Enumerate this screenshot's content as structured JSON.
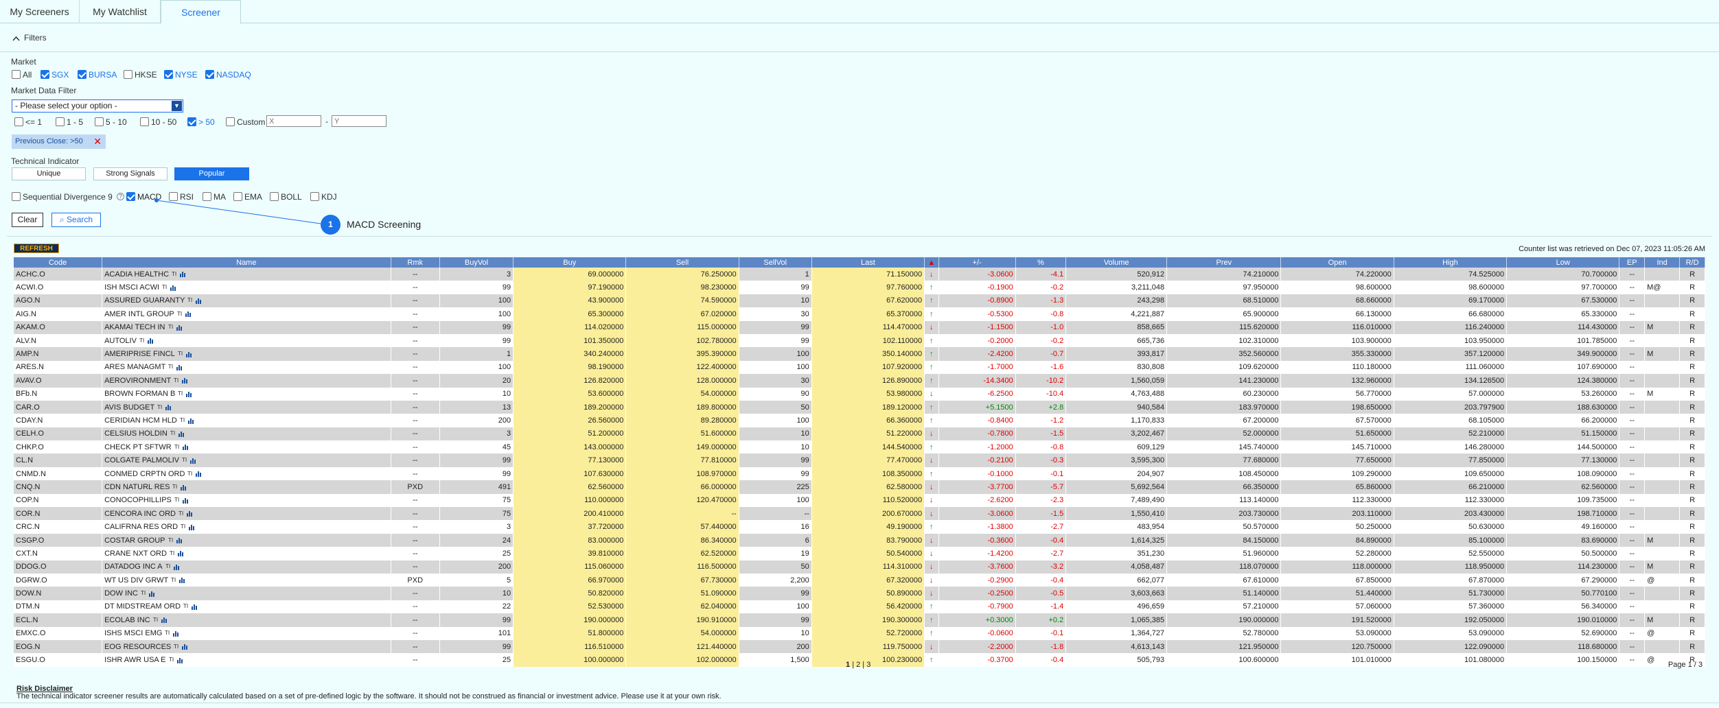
{
  "tabs": [
    {
      "label": "My Screeners",
      "active": false
    },
    {
      "label": "My Watchlist",
      "active": false
    },
    {
      "label": "Screener",
      "active": true
    }
  ],
  "filters": {
    "title": "Filters",
    "market_label": "Market",
    "markets": [
      {
        "label": "All",
        "checked": false
      },
      {
        "label": "SGX",
        "checked": true
      },
      {
        "label": "BURSA",
        "checked": true
      },
      {
        "label": "HKSE",
        "checked": false
      },
      {
        "label": "NYSE",
        "checked": true
      },
      {
        "label": "NASDAQ",
        "checked": true
      }
    ],
    "market_data_label": "Market Data Filter",
    "select_value": "- Please select your option -",
    "price_ranges": [
      {
        "label": "<= 1",
        "checked": false
      },
      {
        "label": "1 - 5",
        "checked": false
      },
      {
        "label": "5 - 10",
        "checked": false
      },
      {
        "label": "10 - 50",
        "checked": false
      },
      {
        "label": "> 50",
        "checked": true
      },
      {
        "label": "Custom",
        "checked": false
      }
    ],
    "custom_x_placeholder": "X",
    "custom_dash": "-",
    "custom_y_placeholder": "Y",
    "chip_label": "Previous Close: >50",
    "tech_label": "Technical Indicator",
    "tech_tabs": [
      {
        "label": "Unique",
        "active": false
      },
      {
        "label": "Strong Signals",
        "active": false
      },
      {
        "label": "Popular",
        "active": true
      }
    ],
    "indicators": [
      {
        "label": "Sequential Divergence 9",
        "checked": false
      },
      {
        "label": "MACD",
        "checked": true
      },
      {
        "label": "RSI",
        "checked": false
      },
      {
        "label": "MA",
        "checked": false
      },
      {
        "label": "EMA",
        "checked": false
      },
      {
        "label": "BOLL",
        "checked": false
      },
      {
        "label": "KDJ",
        "checked": false
      }
    ],
    "help_glyph": "?",
    "clear_label": "Clear",
    "search_label": "Search"
  },
  "callout": {
    "number": "1",
    "text": "MACD Screening"
  },
  "refresh_label": "REFRESH",
  "retrieved_text": "Counter list was retrieved on Dec 07, 2023 11:05:26 AM",
  "table": {
    "headers": [
      "Code",
      "Name",
      "Rmk",
      "BuyVol",
      "Buy",
      "Sell",
      "SellVol",
      "Last",
      "▲",
      "+/-",
      "%",
      "Volume",
      "Prev",
      "Open",
      "High",
      "Low",
      "EP",
      "Ind",
      "R/D"
    ],
    "rows": [
      [
        "ACHC.O",
        "ACADIA HEALTHC",
        "--",
        "3",
        "69.000000",
        "76.250000",
        "1",
        "71.150000",
        "down",
        "-3.0600",
        "-4.1",
        "520,912",
        "74.210000",
        "74.220000",
        "74.525000",
        "70.700000",
        "--",
        "",
        "R"
      ],
      [
        "ACWI.O",
        "ISH MSCI ACWI",
        "--",
        "99",
        "97.190000",
        "98.230000",
        "99",
        "97.760000",
        "up",
        "-0.1900",
        "-0.2",
        "3,211,048",
        "97.950000",
        "98.600000",
        "98.600000",
        "97.700000",
        "--",
        "M@",
        "R"
      ],
      [
        "AGO.N",
        "ASSURED GUARANTY",
        "--",
        "100",
        "43.900000",
        "74.590000",
        "10",
        "67.620000",
        "up",
        "-0.8900",
        "-1.3",
        "243,298",
        "68.510000",
        "68.660000",
        "69.170000",
        "67.530000",
        "--",
        "",
        "R"
      ],
      [
        "AIG.N",
        "AMER INTL GROUP",
        "--",
        "100",
        "65.300000",
        "67.020000",
        "30",
        "65.370000",
        "up",
        "-0.5300",
        "-0.8",
        "4,221,887",
        "65.900000",
        "66.130000",
        "66.680000",
        "65.330000",
        "--",
        "",
        "R"
      ],
      [
        "AKAM.O",
        "AKAMAI TECH IN",
        "--",
        "99",
        "114.020000",
        "115.000000",
        "99",
        "114.470000",
        "down",
        "-1.1500",
        "-1.0",
        "858,665",
        "115.620000",
        "116.010000",
        "116.240000",
        "114.430000",
        "--",
        "M",
        "R"
      ],
      [
        "ALV.N",
        "AUTOLIV",
        "--",
        "99",
        "101.350000",
        "102.780000",
        "99",
        "102.110000",
        "up",
        "-0.2000",
        "-0.2",
        "665,736",
        "102.310000",
        "103.900000",
        "103.950000",
        "101.785000",
        "--",
        "",
        "R"
      ],
      [
        "AMP.N",
        "AMERIPRISE FINCL",
        "--",
        "1",
        "340.240000",
        "395.390000",
        "100",
        "350.140000",
        "up",
        "-2.4200",
        "-0.7",
        "393,817",
        "352.560000",
        "355.330000",
        "357.120000",
        "349.900000",
        "--",
        "M",
        "R"
      ],
      [
        "ARES.N",
        "ARES MANAGMT",
        "--",
        "100",
        "98.190000",
        "122.400000",
        "100",
        "107.920000",
        "up",
        "-1.7000",
        "-1.6",
        "830,808",
        "109.620000",
        "110.180000",
        "111.060000",
        "107.690000",
        "--",
        "",
        "R"
      ],
      [
        "AVAV.O",
        "AEROVIRONMENT",
        "--",
        "20",
        "126.820000",
        "128.000000",
        "30",
        "126.890000",
        "up",
        "-14.3400",
        "-10.2",
        "1,560,059",
        "141.230000",
        "132.960000",
        "134.126500",
        "124.380000",
        "--",
        "",
        "R"
      ],
      [
        "BFb.N",
        "BROWN FORMAN B",
        "--",
        "10",
        "53.600000",
        "54.000000",
        "90",
        "53.980000",
        "down",
        "-6.2500",
        "-10.4",
        "4,763,488",
        "60.230000",
        "56.770000",
        "57.000000",
        "53.260000",
        "--",
        "M",
        "R"
      ],
      [
        "CAR.O",
        "AVIS BUDGET",
        "--",
        "13",
        "189.200000",
        "189.800000",
        "50",
        "189.120000",
        "up",
        "+5.1500",
        "+2.8",
        "940,584",
        "183.970000",
        "198.650000",
        "203.797900",
        "188.630000",
        "--",
        "",
        "R"
      ],
      [
        "CDAY.N",
        "CERIDIAN HCM HLD",
        "--",
        "200",
        "26.560000",
        "89.280000",
        "100",
        "66.360000",
        "up",
        "-0.8400",
        "-1.2",
        "1,170,833",
        "67.200000",
        "67.570000",
        "68.105000",
        "66.200000",
        "--",
        "",
        "R"
      ],
      [
        "CELH.O",
        "CELSIUS HOLDIN",
        "--",
        "3",
        "51.200000",
        "51.600000",
        "10",
        "51.220000",
        "down",
        "-0.7800",
        "-1.5",
        "3,202,467",
        "52.000000",
        "51.650000",
        "52.210000",
        "51.150000",
        "--",
        "",
        "R"
      ],
      [
        "CHKP.O",
        "CHECK PT SFTWR",
        "--",
        "45",
        "143.000000",
        "149.000000",
        "10",
        "144.540000",
        "up",
        "-1.2000",
        "-0.8",
        "609,129",
        "145.740000",
        "145.710000",
        "146.280000",
        "144.500000",
        "--",
        "",
        "R"
      ],
      [
        "CL.N",
        "COLGATE PALMOLIV",
        "--",
        "99",
        "77.130000",
        "77.810000",
        "99",
        "77.470000",
        "down",
        "-0.2100",
        "-0.3",
        "3,595,300",
        "77.680000",
        "77.650000",
        "77.850000",
        "77.130000",
        "--",
        "",
        "R"
      ],
      [
        "CNMD.N",
        "CONMED CRPTN ORD",
        "--",
        "99",
        "107.630000",
        "108.970000",
        "99",
        "108.350000",
        "up",
        "-0.1000",
        "-0.1",
        "204,907",
        "108.450000",
        "109.290000",
        "109.650000",
        "108.090000",
        "--",
        "",
        "R"
      ],
      [
        "CNQ.N",
        "CDN NATURL RES",
        "PXD",
        "491",
        "62.560000",
        "66.000000",
        "225",
        "62.580000",
        "down",
        "-3.7700",
        "-5.7",
        "5,692,564",
        "66.350000",
        "65.860000",
        "66.210000",
        "62.560000",
        "--",
        "",
        "R"
      ],
      [
        "COP.N",
        "CONOCOPHILLIPS",
        "--",
        "75",
        "110.000000",
        "120.470000",
        "100",
        "110.520000",
        "down",
        "-2.6200",
        "-2.3",
        "7,489,490",
        "113.140000",
        "112.330000",
        "112.330000",
        "109.735000",
        "--",
        "",
        "R"
      ],
      [
        "COR.N",
        "CENCORA INC ORD",
        "--",
        "75",
        "200.410000",
        "--",
        "--",
        "200.670000",
        "down",
        "-3.0600",
        "-1.5",
        "1,550,410",
        "203.730000",
        "203.110000",
        "203.430000",
        "198.710000",
        "--",
        "",
        "R"
      ],
      [
        "CRC.N",
        "CALIFRNA RES ORD",
        "--",
        "3",
        "37.720000",
        "57.440000",
        "16",
        "49.190000",
        "up",
        "-1.3800",
        "-2.7",
        "483,954",
        "50.570000",
        "50.250000",
        "50.630000",
        "49.160000",
        "--",
        "",
        "R"
      ],
      [
        "CSGP.O",
        "COSTAR GROUP",
        "--",
        "24",
        "83.000000",
        "86.340000",
        "6",
        "83.790000",
        "down",
        "-0.3600",
        "-0.4",
        "1,614,325",
        "84.150000",
        "84.890000",
        "85.100000",
        "83.690000",
        "--",
        "M",
        "R"
      ],
      [
        "CXT.N",
        "CRANE NXT ORD",
        "--",
        "25",
        "39.810000",
        "62.520000",
        "19",
        "50.540000",
        "down",
        "-1.4200",
        "-2.7",
        "351,230",
        "51.960000",
        "52.280000",
        "52.550000",
        "50.500000",
        "--",
        "",
        "R"
      ],
      [
        "DDOG.O",
        "DATADOG INC A",
        "--",
        "200",
        "115.060000",
        "116.500000",
        "50",
        "114.310000",
        "down",
        "-3.7600",
        "-3.2",
        "4,058,487",
        "118.070000",
        "118.000000",
        "118.950000",
        "114.230000",
        "--",
        "M",
        "R"
      ],
      [
        "DGRW.O",
        "WT US DIV GRWT",
        "PXD",
        "5",
        "66.970000",
        "67.730000",
        "2,200",
        "67.320000",
        "down",
        "-0.2900",
        "-0.4",
        "662,077",
        "67.610000",
        "67.850000",
        "67.870000",
        "67.290000",
        "--",
        "@",
        "R"
      ],
      [
        "DOW.N",
        "DOW INC",
        "--",
        "10",
        "50.820000",
        "51.090000",
        "99",
        "50.890000",
        "down",
        "-0.2500",
        "-0.5",
        "3,603,663",
        "51.140000",
        "51.440000",
        "51.730000",
        "50.770100",
        "--",
        "",
        "R"
      ],
      [
        "DTM.N",
        "DT MIDSTREAM ORD",
        "--",
        "22",
        "52.530000",
        "62.040000",
        "100",
        "56.420000",
        "up",
        "-0.7900",
        "-1.4",
        "496,659",
        "57.210000",
        "57.060000",
        "57.360000",
        "56.340000",
        "--",
        "",
        "R"
      ],
      [
        "ECL.N",
        "ECOLAB INC",
        "--",
        "99",
        "190.000000",
        "190.910000",
        "99",
        "190.300000",
        "up",
        "+0.3000",
        "+0.2",
        "1,065,385",
        "190.000000",
        "191.520000",
        "192.050000",
        "190.010000",
        "--",
        "M",
        "R"
      ],
      [
        "EMXC.O",
        "ISHS MSCI EMG",
        "--",
        "101",
        "51.800000",
        "54.000000",
        "10",
        "52.720000",
        "up",
        "-0.0600",
        "-0.1",
        "1,364,727",
        "52.780000",
        "53.090000",
        "53.090000",
        "52.690000",
        "--",
        "@",
        "R"
      ],
      [
        "EOG.N",
        "EOG RESOURCES",
        "--",
        "99",
        "116.510000",
        "121.440000",
        "200",
        "119.750000",
        "down",
        "-2.2000",
        "-1.8",
        "4,613,143",
        "121.950000",
        "120.750000",
        "122.090000",
        "118.680000",
        "--",
        "",
        "R"
      ],
      [
        "ESGU.O",
        "ISHR AWR USA E",
        "--",
        "25",
        "100.000000",
        "102.000000",
        "1,500",
        "100.230000",
        "up",
        "-0.3700",
        "-0.4",
        "505,793",
        "100.600000",
        "101.010000",
        "101.080000",
        "100.150000",
        "--",
        "@",
        "R"
      ]
    ]
  },
  "pager": {
    "p1": "1",
    "sep1": "|",
    "p2": "2",
    "sep2": "|",
    "p3": "3"
  },
  "page_info": "Page 1 / 3",
  "disclaimer": {
    "title": "Risk Disclaimer",
    "text": "The technical indicator screener results are automatically calculated based on a set of pre-defined logic by the software. It should not be construed as financial or investment advice. Please use it at your own risk."
  },
  "colors": {
    "accent": "#1a73e8",
    "header": "#5d86c6",
    "highlight": "#fbee9a",
    "negative": "#e00000",
    "positive": "#008a00"
  }
}
